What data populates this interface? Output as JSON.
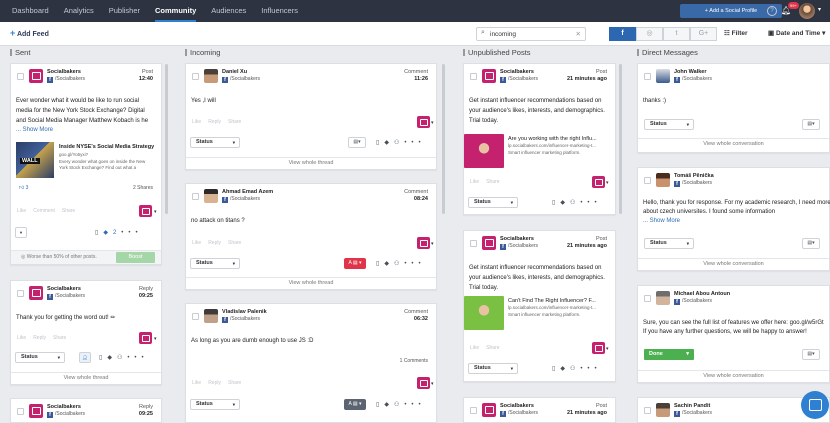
{
  "nav": {
    "items": [
      "Dashboard",
      "Analytics",
      "Publisher",
      "Community",
      "Audiences",
      "Influencers"
    ],
    "active": "Community",
    "add_profile": "+ Add a Social Profile",
    "badge": "99+"
  },
  "toolbar": {
    "add_feed": "Add Feed",
    "search_value": "incoming",
    "networks": [
      "f",
      "◎",
      "t",
      "G+"
    ],
    "filter": "Filter",
    "date_time": "Date and Time"
  },
  "columns": {
    "sent": {
      "title": "Sent",
      "cards": [
        {
          "name": "Socialbakers",
          "page": "/Socialbakers",
          "type": "Post",
          "time": "12:40",
          "line1": "Ever wonder what it would be like to run social",
          "line2": "media for the New York Stock Exchange? Digital",
          "line3": "and Social Media Manager Matthew Kobach is he",
          "more": "... Show More",
          "link_title1": "Inside NYSE's Social Media Strategy",
          "link_url": "goo.gl/Yo5yxi?",
          "link_desc1": "Every wonder what goes on inside the New",
          "link_desc2": "York Stock Exchange? Find out what a",
          "wall": "WALL",
          "likes": "3",
          "shares": "2 Shares",
          "tag_count": "2",
          "performance": "Worse than 50% of other posts.",
          "boost": "Boost"
        },
        {
          "name": "Socialbakers",
          "page": "/Socialbakers",
          "type": "Reply",
          "time": "09:25",
          "line1": "Thank you for getting the word out! ✏",
          "status": "Status",
          "view": "View whole thread"
        },
        {
          "name": "Socialbakers",
          "page": "/Socialbakers",
          "type": "Reply",
          "time": "09:25"
        }
      ]
    },
    "incoming": {
      "title": "Incoming",
      "cards": [
        {
          "name": "Daniel Xu",
          "page": "/Socialbakers",
          "type": "Comment",
          "time": "11:26",
          "line1": "Yes ,I will",
          "status": "Status",
          "view": "View whole thread"
        },
        {
          "name": "Ahmad Emad Azem",
          "page": "/Socialbakers",
          "type": "Comment",
          "time": "08:24",
          "line1": "no attack on titans ?",
          "status": "Status",
          "view": "View whole thread"
        },
        {
          "name": "Vladislav Palenik",
          "page": "/Socialbakers",
          "type": "Comment",
          "time": "06:32",
          "line1": "As long as you are dumb enough to use JS :D",
          "comments": "1 Comments",
          "status": "Status"
        }
      ]
    },
    "unpublished": {
      "title": "Unpublished Posts",
      "cards": [
        {
          "name": "Socialbakers",
          "page": "/Socialbakers",
          "type": "Post",
          "time": "21 minutes ago",
          "line1": "Get instant influencer recommendations based on",
          "line2": "your audience's likes, interests, and demographics.",
          "line3": "Trial today.",
          "promo_title1": "Are you working with the right Influ...",
          "promo_url": "lp.socialbakers.com/influencer-marketing-t...",
          "promo_desc": "Smart influencer marketing platform.",
          "status": "Status"
        },
        {
          "name": "Socialbakers",
          "page": "/Socialbakers",
          "type": "Post",
          "time": "21 minutes ago",
          "line1": "Get instant influencer recommendations based on",
          "line2": "your audience's likes, interests, and demographics.",
          "line3": "Trial today.",
          "promo_title1": "Can't Find The Right Influencer? F...",
          "promo_url": "lp.socialbakers.com/influencer-marketing-t...",
          "promo_desc": "Smart influencer marketing platform.",
          "status": "Status"
        },
        {
          "name": "Socialbakers",
          "page": "/Socialbakers",
          "type": "Post",
          "time": "21 minutes ago"
        }
      ]
    },
    "direct": {
      "title": "Direct Messages",
      "cards": [
        {
          "name": "John Walker",
          "page": "/Socialbakers",
          "line1": "thanks :)",
          "status": "Status",
          "view": "View whole conversation"
        },
        {
          "name": "Tomáš Pěnička",
          "page": "/Socialbakers",
          "line1": "Hello, thank you for response. For my academic research, I need more",
          "line2": "about czech universites. I found some information",
          "more": "... Show More",
          "status": "Status",
          "view": "View whole conversation"
        },
        {
          "name": "Michael Abou Antoun",
          "page": "/Socialbakers",
          "line1": "Sure, you can see the full list of features we offer here: goo.gl/w5rGt",
          "line2": "If you have any further questions, we will be happy to answer!",
          "done": "Done",
          "view": "View whole conversation"
        },
        {
          "name": "Sachin Pandit",
          "page": "/Socialbakers"
        }
      ]
    }
  },
  "actions": {
    "like": "Like",
    "reply": "Reply",
    "share": "Share",
    "comment": "Comment"
  },
  "colors": {
    "nav_bg": "#2d3340",
    "accent": "#2f80d1",
    "brand_pink": "#c4226e",
    "done_green": "#4caf50",
    "facebook": "#3b5998"
  }
}
